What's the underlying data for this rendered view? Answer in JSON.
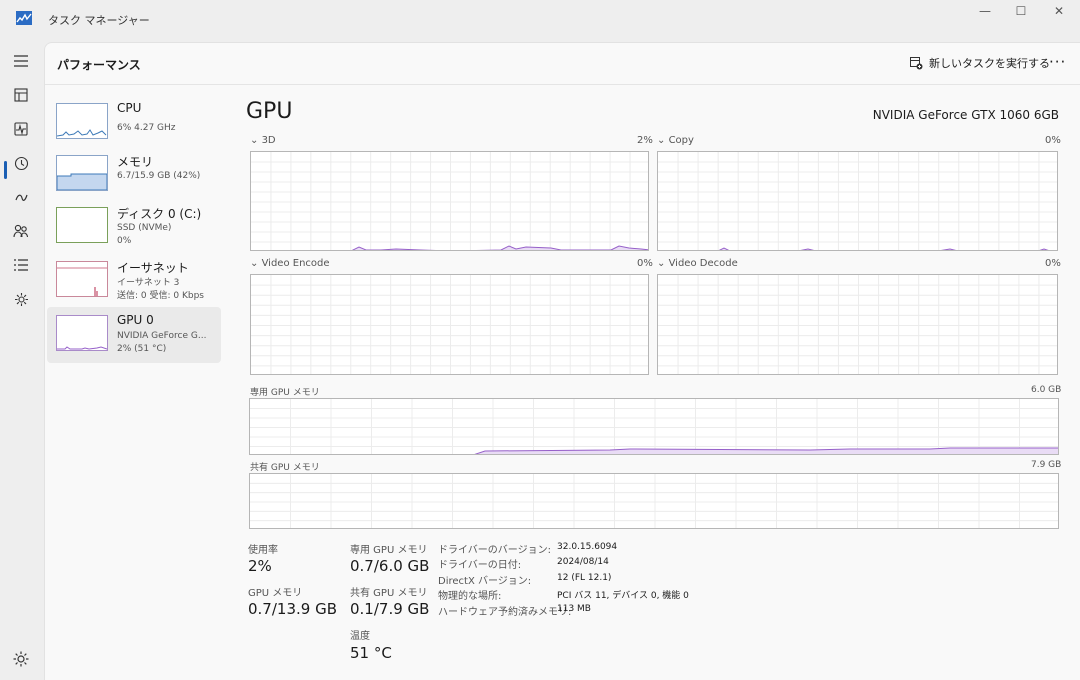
{
  "window": {
    "title": "タスク マネージャー",
    "minimize": "—",
    "maximize": "☐",
    "close": "✕"
  },
  "nav": {
    "icons": [
      "hamburger-icon",
      "processes-icon",
      "performance-icon",
      "app-history-icon",
      "startup-apps-icon",
      "users-icon",
      "details-icon",
      "services-icon"
    ],
    "settings_icon": "gear-icon"
  },
  "header": {
    "title": "パフォーマンス",
    "new_task_label": "新しいタスクを実行する",
    "more_label": "···"
  },
  "sidebar": {
    "items": [
      {
        "name": "CPU",
        "sub1": "6% 4.27 GHz",
        "sub2": ""
      },
      {
        "name": "メモリ",
        "sub1": "6.7/15.9 GB (42%)",
        "sub2": ""
      },
      {
        "name": "ディスク 0 (C:)",
        "sub1": "SSD (NVMe)",
        "sub2": "0%"
      },
      {
        "name": "イーサネット",
        "sub1": "イーサネット 3",
        "sub2": "送信: 0 受信: 0 Kbps"
      },
      {
        "name": "GPU 0",
        "sub1": "NVIDIA GeForce G...",
        "sub2": "2% (51 °C)"
      }
    ]
  },
  "gpu": {
    "title": "GPU",
    "model": "NVIDIA GeForce GTX 1060 6GB",
    "engines": [
      {
        "label": "3D",
        "value": "2%"
      },
      {
        "label": "Copy",
        "value": "0%"
      },
      {
        "label": "Video Encode",
        "value": "0%"
      },
      {
        "label": "Video Decode",
        "value": "0%"
      }
    ],
    "dedicated": {
      "label": "専用 GPU メモリ",
      "max": "6.0 GB"
    },
    "shared": {
      "label": "共有 GPU メモリ",
      "max": "7.9 GB"
    }
  },
  "stats": {
    "usage_label": "使用率",
    "usage_value": "2%",
    "dedicated_label": "専用 GPU メモリ",
    "dedicated_value": "0.7/6.0 GB",
    "gpu_mem_label": "GPU メモリ",
    "gpu_mem_value": "0.7/13.9 GB",
    "shared_label": "共有 GPU メモリ",
    "shared_value": "0.1/7.9 GB",
    "temp_label": "温度",
    "temp_value": "51 °C"
  },
  "info": [
    {
      "key": "ドライバーのバージョン:",
      "value": "32.0.15.6094"
    },
    {
      "key": "ドライバーの日付:",
      "value": "2024/08/14"
    },
    {
      "key": "DirectX バージョン:",
      "value": "12 (FL 12.1)"
    },
    {
      "key": "物理的な場所:",
      "value": "PCI バス 11, デバイス 0, 機能 0"
    },
    {
      "key": "ハードウェア予約済みメモリ:",
      "value": "113 MB"
    }
  ],
  "colors": {
    "gpu_line": "#9660c9",
    "gpu_fill": "#e9dcf5",
    "cpu_line": "#3d7ab8",
    "mem_fill": "#c4d7ef",
    "net_line": "#c04a68",
    "accent": "#1a5fb4"
  }
}
